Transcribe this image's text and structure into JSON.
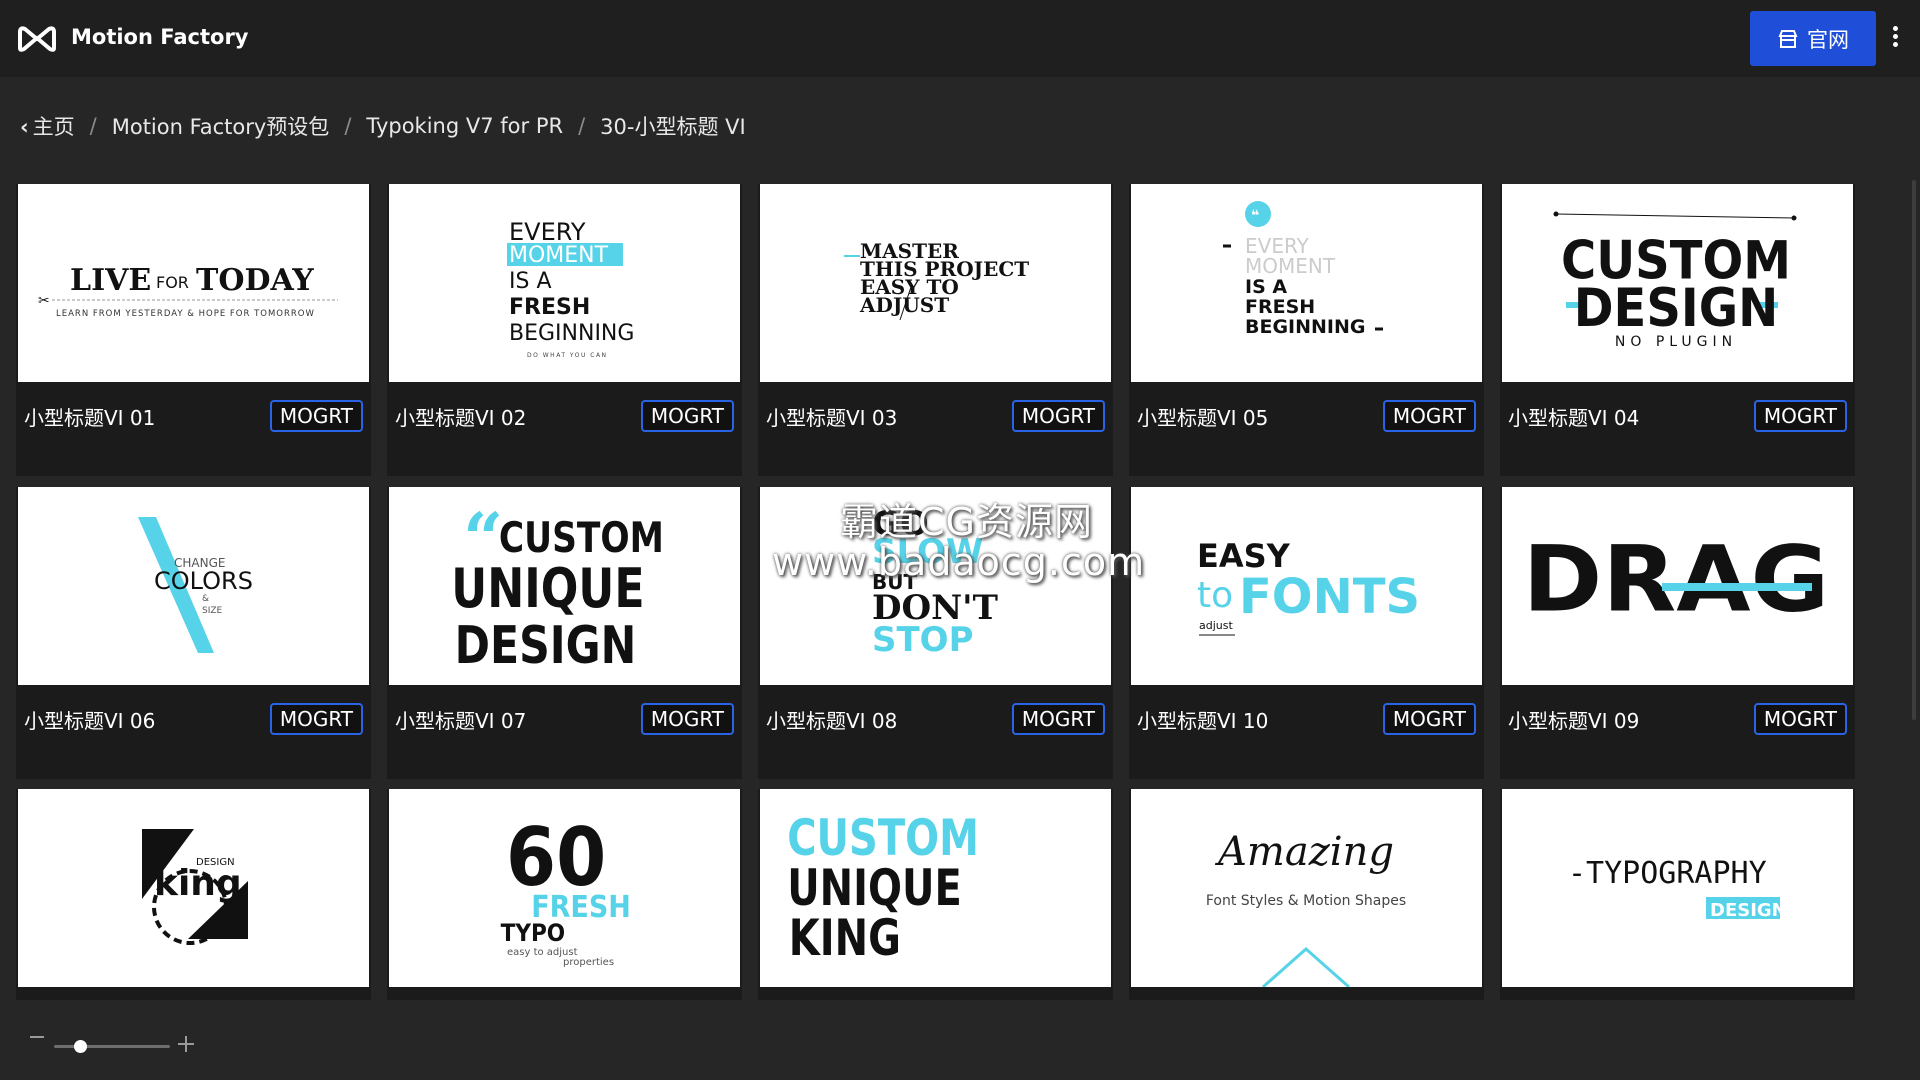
{
  "app": {
    "title": "Motion Factory",
    "brand_color": "#1f4fd9"
  },
  "header": {
    "site_button_label": "官网",
    "site_icon": "store-icon",
    "menu_icon": "kebab-menu-icon"
  },
  "breadcrumb": [
    {
      "label": "主页"
    },
    {
      "label": "Motion Factory预设包"
    },
    {
      "label": "Typoking V7 for PR"
    },
    {
      "label": "30-小型标题 VI"
    }
  ],
  "badge_label": "MOGRT",
  "cards": [
    {
      "name": "小型标题VI 01",
      "thumb": [
        "LIVE",
        "FOR",
        "TODAY",
        "LEARN FROM YESTERDAY & HOPE FOR TOMORROW"
      ]
    },
    {
      "name": "小型标题VI 02",
      "thumb": [
        "EVERY",
        "MOMENT",
        "IS A",
        "FRESH",
        "BEGINNING",
        "DO WHAT YOU CAN"
      ]
    },
    {
      "name": "小型标题VI 03",
      "thumb": [
        "MASTER",
        "THIS PROJECT",
        "EASY TO",
        "ADJUST"
      ]
    },
    {
      "name": "小型标题VI 05",
      "thumb": [
        "EVERY",
        "MOMENT",
        "IS A",
        "FRESH",
        "BEGINNING"
      ]
    },
    {
      "name": "小型标题VI 04",
      "thumb": [
        "CUSTOM",
        "DESIGN",
        "NO PLUGIN"
      ]
    },
    {
      "name": "小型标题VI 06",
      "thumb": [
        "CHANGE",
        "COLORS",
        "&",
        "SIZE"
      ]
    },
    {
      "name": "小型标题VI 07",
      "thumb": [
        "CUSTOM",
        "UNIQUE",
        "DESIGN"
      ]
    },
    {
      "name": "小型标题VI 08",
      "thumb": [
        "GO",
        "SLOW",
        "BUT",
        "DON'T",
        "STOP"
      ]
    },
    {
      "name": "小型标题VI 10",
      "thumb": [
        "EASY",
        "to",
        "FONTS",
        "adjust"
      ]
    },
    {
      "name": "小型标题VI 09",
      "thumb": [
        "DRAG"
      ]
    },
    {
      "name": "",
      "thumb": [
        "DESIGN",
        "king"
      ]
    },
    {
      "name": "",
      "thumb": [
        "60",
        "FRESH",
        "TYPO",
        "easy to adjust",
        "properties"
      ]
    },
    {
      "name": "",
      "thumb": [
        "CUSTOM",
        "UNIQUE",
        "KING"
      ]
    },
    {
      "name": "",
      "thumb": [
        "Amazing",
        "Font Styles & Motion Shapes"
      ]
    },
    {
      "name": "",
      "thumb": [
        "-TYPOGRAPHY",
        "DESIGN"
      ]
    }
  ],
  "watermark": [
    "霸道CG资源网",
    "www.badaocg.com"
  ],
  "colors": {
    "accent_cyan": "#56d3e8",
    "badge_border": "#2a63e6"
  }
}
